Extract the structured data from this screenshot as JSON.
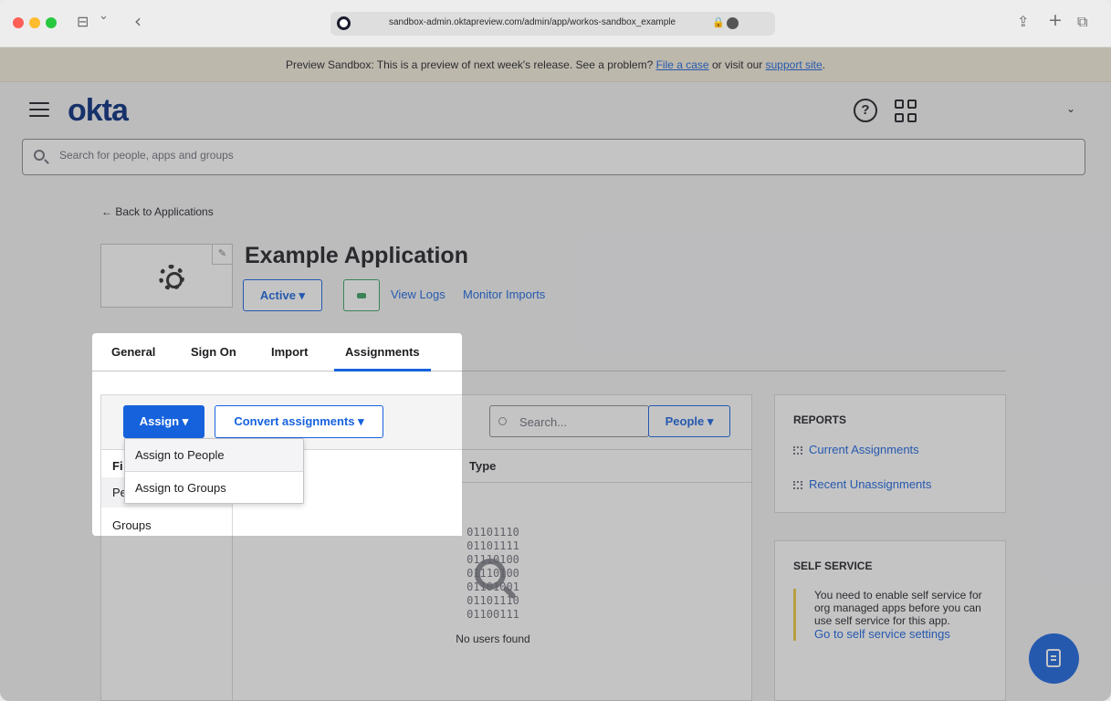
{
  "browser": {
    "url": "sandbox-admin.oktapreview.com/admin/app/workos-sandbox_example",
    "nav_back": "‹",
    "sidebar_icon": "⊟",
    "chevron": "⌄",
    "share_icon": "⇪",
    "new_tab_icon": "+",
    "tabs_icon": "⧉"
  },
  "banner": {
    "text_before": "Preview Sandbox: This is a preview of next week's release. See a problem? ",
    "file_case_link": "File a case",
    "text_middle": " or visit our ",
    "support_link": "support site",
    "text_after": "."
  },
  "header": {
    "logo": "okta",
    "help_glyph": "?",
    "user_chevron": "⌄"
  },
  "search": {
    "placeholder": "Search for people, apps and groups"
  },
  "page": {
    "back_link": "← Back to Applications",
    "app_title": "Example Application",
    "status_button": "Active ▾",
    "view_logs": "View Logs",
    "monitor_imports": "Monitor Imports"
  },
  "tabs": [
    "General",
    "Sign On",
    "Import",
    "Assignments"
  ],
  "toolbar": {
    "assign_button": "Assign ▾",
    "convert_button": "Convert assignments ▾",
    "search_placeholder": "Search...",
    "people_button": "People ▾"
  },
  "assign_menu": [
    "Assign to People",
    "Assign to Groups"
  ],
  "filters": {
    "header_partial": "Fi",
    "people_partial": "Pe",
    "groups": "Groups"
  },
  "table": {
    "type_header": "Type",
    "binary_lines": [
      "01101110",
      "01101111",
      "01110100",
      "01110100",
      "01101001",
      "01101110",
      "01100111"
    ],
    "empty_text": "No users found"
  },
  "reports": {
    "title": "REPORTS",
    "current": "Current Assignments",
    "recent": "Recent Unassignments"
  },
  "self_service": {
    "title": "SELF SERVICE",
    "note": "You need to enable self service for org managed apps before you can use self service for this app.",
    "link": "Go to self service settings"
  },
  "colors": {
    "accent": "#1662dd",
    "brand": "#00297a",
    "banner": "#f5eedb",
    "note_bar": "#eaca3d"
  }
}
